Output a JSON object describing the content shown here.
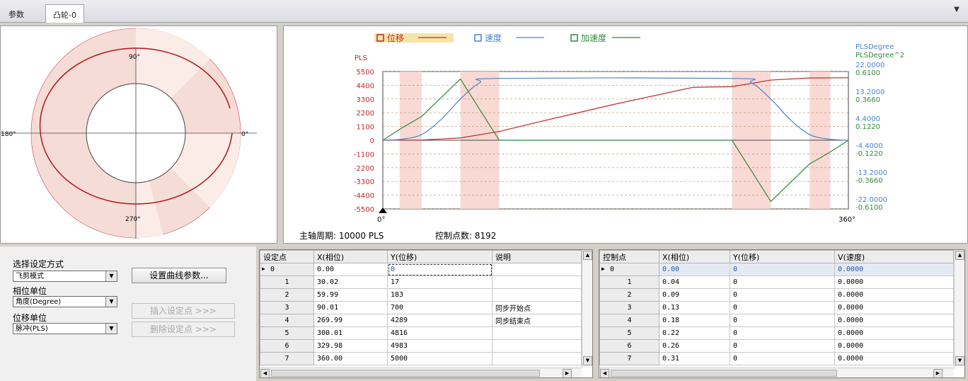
{
  "tabs": [
    {
      "label": "参数"
    },
    {
      "label": "凸轮-0"
    }
  ],
  "polar": {
    "labels": {
      "top": "90°",
      "left": "180°",
      "right": "0°",
      "bottom": "270°"
    }
  },
  "chart_data": {
    "type": "line",
    "legend": [
      {
        "name": "位移",
        "color": "#c0282a"
      },
      {
        "name": "速度",
        "color": "#4a82d0"
      },
      {
        "name": "加速度",
        "color": "#2e8b3a"
      }
    ],
    "ylabel_left": "PLS",
    "ylabel_right_1": "PLSDegree",
    "ylabel_right_2": "PLSDegree^2",
    "yticks_left": [
      "5500",
      "4400",
      "3300",
      "2200",
      "1100",
      "0",
      "-1100",
      "-2200",
      "-3300",
      "-4400",
      "-5500"
    ],
    "yticks_right_velocity": [
      "22.0000",
      "13.2000",
      "4.4000",
      "-4.4000",
      "-13.2000",
      "-22.0000"
    ],
    "yticks_right_accel": [
      "0.6100",
      "0.3660",
      "0.1220",
      "-0.1220",
      "-0.3660",
      "-0.6100"
    ],
    "x_start_label": "0°",
    "x_end_label": "360°",
    "xlim": [
      0,
      360
    ],
    "ylim": [
      -5500,
      5500
    ],
    "series": [
      {
        "name": "位移",
        "x": [
          0,
          30,
          60,
          90,
          120,
          180,
          240,
          270,
          300,
          330,
          360
        ],
        "y": [
          0,
          17,
          183,
          700,
          1450,
          2900,
          4240,
          4289,
          4816,
          4983,
          5000
        ]
      },
      {
        "name": "速度",
        "x": [
          0,
          15,
          30,
          45,
          60,
          75,
          90,
          270,
          285,
          300,
          315,
          330,
          345,
          360
        ],
        "y": [
          0,
          90,
          450,
          1650,
          3300,
          4600,
          4950,
          4950,
          4600,
          3300,
          1650,
          450,
          90,
          0
        ]
      },
      {
        "name": "加速度",
        "x": [
          0,
          15,
          30,
          60,
          90,
          270,
          300,
          330,
          345,
          360
        ],
        "y": [
          0,
          1000,
          1900,
          4900,
          0,
          0,
          -4900,
          -1900,
          -1000,
          0
        ]
      }
    ],
    "shaded_regions": [
      [
        13,
        30
      ],
      [
        60,
        90
      ],
      [
        270,
        300
      ],
      [
        330,
        346
      ]
    ]
  },
  "chart_footer": {
    "period_label": "主轴周期: 10000 PLS",
    "points_label": "控制点数: 8192"
  },
  "controls": {
    "mode_label": "选择设定方式",
    "mode_value": "飞剪模式",
    "setup_button": "设置曲线参数...",
    "phase_unit_label": "相位单位",
    "phase_unit_value": "角度(Degree)",
    "insert_button": "插入设定点 >>>",
    "disp_unit_label": "位移单位",
    "disp_unit_value": "脉冲(PLS)",
    "delete_button": "删除设定点 >>>"
  },
  "settings_table": {
    "headers": [
      "设定点",
      "X(相位)",
      "Y(位移)",
      "说明"
    ],
    "rows": [
      [
        "0",
        "0.00",
        "0",
        ""
      ],
      [
        "1",
        "30.02",
        "17",
        ""
      ],
      [
        "2",
        "59.99",
        "183",
        ""
      ],
      [
        "3",
        "90.01",
        "700",
        "同步开始点"
      ],
      [
        "4",
        "269.99",
        "4289",
        "同步结束点"
      ],
      [
        "5",
        "300.01",
        "4816",
        ""
      ],
      [
        "6",
        "329.98",
        "4983",
        ""
      ],
      [
        "7",
        "360.00",
        "5000",
        ""
      ]
    ]
  },
  "control_table": {
    "headers": [
      "控制点",
      "X(相位)",
      "Y(位移)",
      "V(速度)"
    ],
    "rows": [
      [
        "0",
        "0.00",
        "0",
        "0.0000"
      ],
      [
        "1",
        "0.04",
        "0",
        "0.0000"
      ],
      [
        "2",
        "0.09",
        "0",
        "0.0000"
      ],
      [
        "3",
        "0.13",
        "0",
        "0.0000"
      ],
      [
        "4",
        "0.18",
        "0",
        "0.0000"
      ],
      [
        "5",
        "0.22",
        "0",
        "0.0000"
      ],
      [
        "6",
        "0.26",
        "0",
        "0.0000"
      ],
      [
        "7",
        "0.31",
        "0",
        "0.0000"
      ]
    ]
  }
}
